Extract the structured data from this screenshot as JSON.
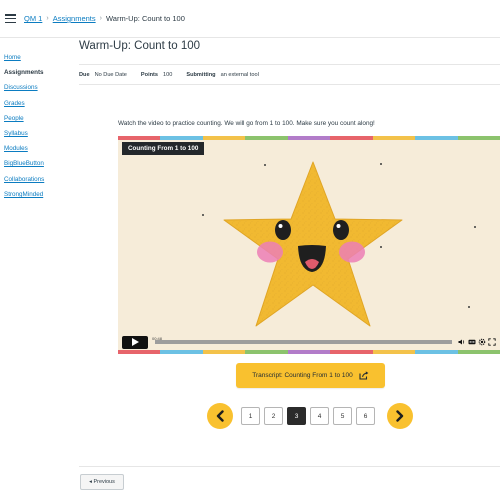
{
  "breadcrumb": {
    "course": "QM 1",
    "section": "Assignments",
    "current": "Warm-Up: Count to 100"
  },
  "sidebar": {
    "items": [
      {
        "label": "Home"
      },
      {
        "label": "Assignments"
      },
      {
        "label": "Discussions"
      },
      {
        "label": "Grades"
      },
      {
        "label": "People"
      },
      {
        "label": "Syllabus"
      },
      {
        "label": "Modules"
      },
      {
        "label": "BigBlueButton"
      },
      {
        "label": "Collaborations"
      },
      {
        "label": "StrongMinded"
      }
    ],
    "active_index": 1
  },
  "assignment": {
    "title": "Warm-Up: Count to 100",
    "due_label": "Due",
    "due_value": "No Due Date",
    "points_label": "Points",
    "points_value": "100",
    "submitting_label": "Submitting",
    "submitting_value": "an external tool",
    "intro": "Watch the video to practice counting. We will go from 1 to 100. Make sure you count along!"
  },
  "video": {
    "title": "Counting From 1 to 100",
    "time": "00:48",
    "stripe_colors": [
      "#e7646b",
      "#6cc1e4",
      "#f3c24a",
      "#8cc36d",
      "#b27cc9",
      "#e7646b",
      "#f3c24a",
      "#6cc1e4",
      "#8cc36d"
    ],
    "background": "#f6ecd9",
    "star_color": "#f1b931"
  },
  "transcript": {
    "label": "Transcript: Counting From 1 to 100"
  },
  "pagination": {
    "pages": [
      "1",
      "2",
      "3",
      "4",
      "5",
      "6"
    ],
    "current": "3"
  },
  "footer": {
    "previous_label": "◂ Previous"
  },
  "colors": {
    "accent": "#f9c12f",
    "link": "#0b7cc1",
    "text": "#2d3b45"
  }
}
